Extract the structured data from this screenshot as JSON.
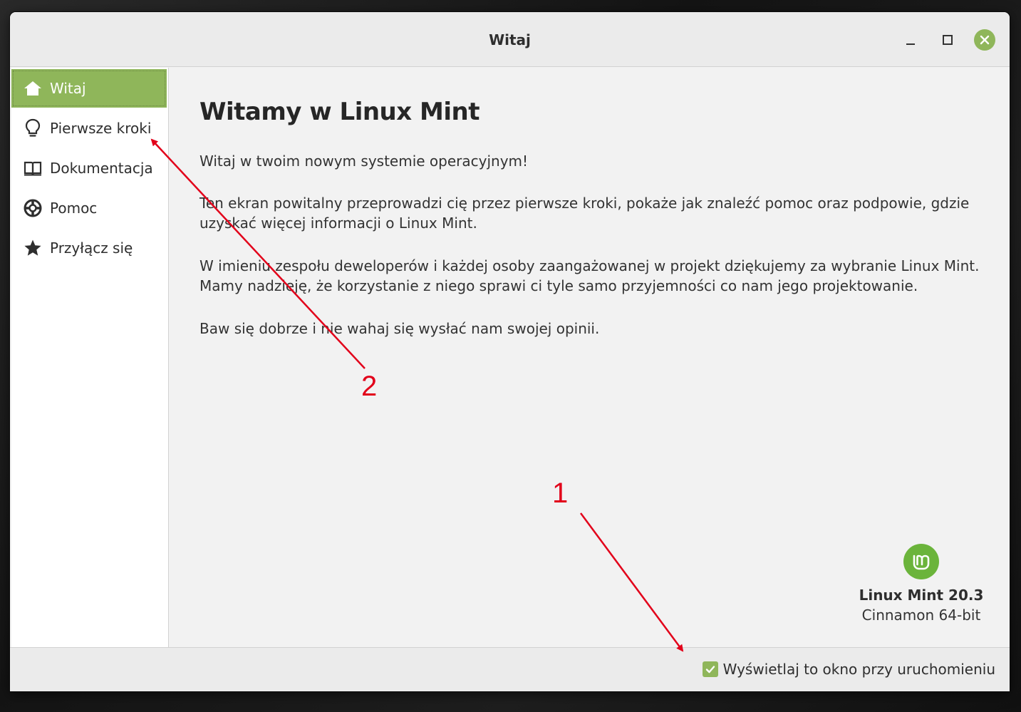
{
  "window": {
    "title": "Witaj"
  },
  "sidebar": {
    "items": [
      {
        "label": "Witaj",
        "icon": "home-icon",
        "active": true
      },
      {
        "label": "Pierwsze kroki",
        "icon": "lightbulb-icon",
        "active": false
      },
      {
        "label": "Dokumentacja",
        "icon": "book-icon",
        "active": false
      },
      {
        "label": "Pomoc",
        "icon": "lifebuoy-icon",
        "active": false
      },
      {
        "label": "Przyłącz się",
        "icon": "star-icon",
        "active": false
      }
    ]
  },
  "main": {
    "heading": "Witamy w Linux Mint",
    "paragraphs": [
      "Witaj w twoim nowym systemie operacyjnym!",
      "Ten ekran powitalny przeprowadzi cię przez pierwsze kroki, pokaże jak znaleźć pomoc oraz podpowie, gdzie uzyskać więcej informacji o Linux Mint.",
      "W imieniu zespołu deweloperów i każdej osoby zaangażowanej w projekt dziękujemy za wybranie Linux Mint. Mamy nadzieję, że korzystanie z niego sprawi ci tyle samo przyjemności co nam jego projektowanie.",
      "Baw się dobrze i nie wahaj się wysłać nam swojej opinii."
    ],
    "brand": {
      "name": "Linux Mint 20.3",
      "edition": "Cinnamon 64-bit"
    }
  },
  "footer": {
    "startup_label": "Wyświetlaj to okno przy uruchomieniu",
    "startup_checked": true
  },
  "annotations": {
    "marker_1": "1",
    "marker_2": "2"
  },
  "colors": {
    "accent": "#8fb65a",
    "mint_logo": "#6bb43b",
    "annotation_red": "#e2001a"
  }
}
